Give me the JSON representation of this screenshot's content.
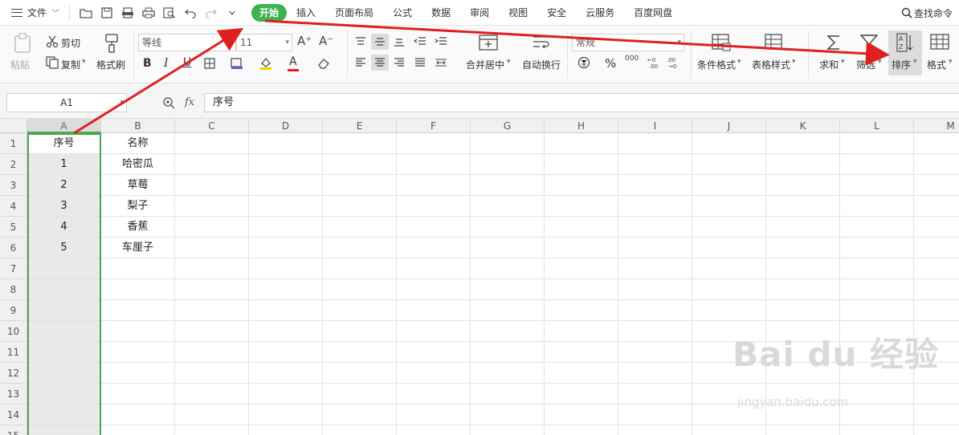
{
  "menubar": {
    "file_label": "文件",
    "tabs": [
      {
        "label": "开始"
      },
      {
        "label": "插入"
      },
      {
        "label": "页面布局"
      },
      {
        "label": "公式"
      },
      {
        "label": "数据"
      },
      {
        "label": "审阅"
      },
      {
        "label": "视图"
      },
      {
        "label": "安全"
      },
      {
        "label": "云服务"
      },
      {
        "label": "百度网盘"
      }
    ],
    "search_label": "查找命令"
  },
  "ribbon": {
    "paste": "粘贴",
    "cut": "剪切",
    "copy": "复制",
    "format_painter": "格式刷",
    "font_name": "等线",
    "font_size": "11",
    "merge_center": "合并居中",
    "wrap_text": "自动换行",
    "number_format": "常规",
    "conditional_format": "条件格式",
    "table_style": "表格样式",
    "sum": "求和",
    "filter": "筛选",
    "sort": "排序",
    "format": "格式",
    "percent_symbol": "%",
    "thousands_symbol": "000",
    "font_size_up": "A⁺",
    "font_size_down": "A⁻"
  },
  "formula_bar": {
    "name_box": "A1",
    "fx_label": "fx",
    "content": "序号"
  },
  "sheet": {
    "columns": [
      "A",
      "B",
      "C",
      "D",
      "E",
      "F",
      "G",
      "H",
      "I",
      "J",
      "K",
      "L",
      "M"
    ],
    "row_numbers": [
      "1",
      "2",
      "3",
      "4",
      "5",
      "6",
      "7",
      "8",
      "9",
      "10",
      "11",
      "12",
      "13",
      "14",
      "15"
    ],
    "col_a": [
      "序号",
      "1",
      "2",
      "3",
      "4",
      "5"
    ],
    "col_b": [
      "名称",
      "哈密瓜",
      "草莓",
      "梨子",
      "香蕉",
      "车厘子"
    ]
  },
  "colors": {
    "active_tab": "#3cb34f",
    "selection": "#4aa84e",
    "annotation_arrow": "#e02020"
  },
  "watermark": {
    "brand": "Bai du 经验",
    "url": "jingyan.baidu.com"
  }
}
